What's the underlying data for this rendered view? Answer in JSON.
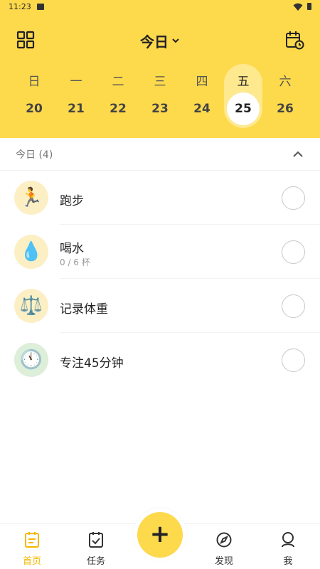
{
  "status": {
    "time": "11:23"
  },
  "header": {
    "title": "今日"
  },
  "week": [
    {
      "weekday": "日",
      "date": "20",
      "selected": false
    },
    {
      "weekday": "一",
      "date": "21",
      "selected": false
    },
    {
      "weekday": "二",
      "date": "22",
      "selected": false
    },
    {
      "weekday": "三",
      "date": "23",
      "selected": false
    },
    {
      "weekday": "四",
      "date": "24",
      "selected": false
    },
    {
      "weekday": "五",
      "date": "25",
      "selected": true
    },
    {
      "weekday": "六",
      "date": "26",
      "selected": false
    }
  ],
  "section": {
    "label": "今日 (4)"
  },
  "tasks": [
    {
      "name": "跑步",
      "emoji": "🏃",
      "sub": "",
      "done": false
    },
    {
      "name": "喝水",
      "emoji": "💧",
      "sub": "0 / 6 杯",
      "done": false
    },
    {
      "name": "记录体重",
      "emoji": "⚖️",
      "sub": "",
      "done": false
    },
    {
      "name": "专注45分钟",
      "emoji": "🕚",
      "sub": "",
      "done": false
    }
  ],
  "tabbar": {
    "home": "首页",
    "tasks": "任务",
    "add": "+",
    "discover": "发现",
    "me": "我",
    "active_color": "#F5B800"
  },
  "colors": {
    "accent": "#FDD94C",
    "selected_pill": "#FFE98F"
  }
}
